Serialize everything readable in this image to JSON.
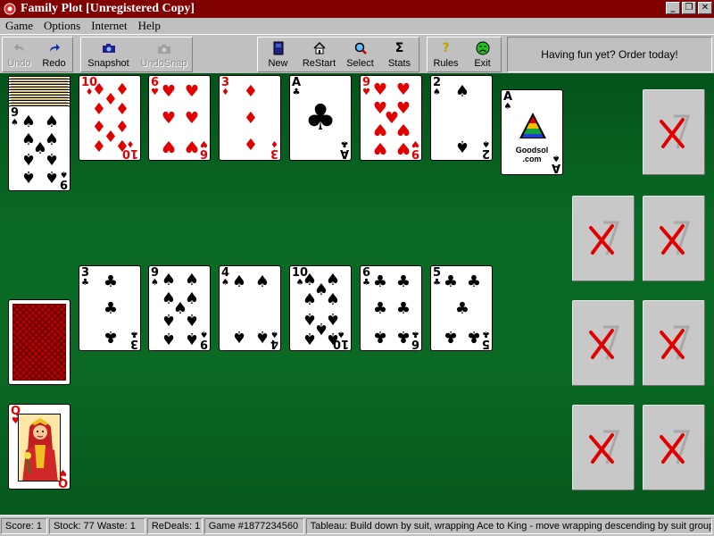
{
  "window": {
    "title": "Family Plot [Unregistered Copy]"
  },
  "menu": {
    "items": [
      "Game",
      "Options",
      "Internet",
      "Help"
    ]
  },
  "toolbar": {
    "undo": "Undo",
    "redo": "Redo",
    "snapshot": "Snapshot",
    "undosnap": "UndoSnap",
    "new": "New",
    "restart": "ReStart",
    "select": "Select",
    "stats": "Stats",
    "rules": "Rules",
    "exit": "Exit",
    "promo": "Having fun yet?  Order today!"
  },
  "cards": {
    "stock_top": {
      "rank": "9",
      "suit": "♠"
    },
    "foundation_ace": {
      "rank": "A",
      "suit": "♠",
      "brand": "Goodsol",
      "brand2": ".com"
    },
    "queen": {
      "rank": "Q",
      "suit": "♥"
    },
    "top_row": [
      {
        "rank": "10",
        "suit": "♦"
      },
      {
        "rank": "6",
        "suit": "♥"
      },
      {
        "rank": "3",
        "suit": "♦"
      },
      {
        "rank": "A",
        "suit": "♣"
      },
      {
        "rank": "9",
        "suit": "♥"
      },
      {
        "rank": "2",
        "suit": "♠"
      }
    ],
    "middle_row": [
      {
        "rank": "3",
        "suit": "♣"
      },
      {
        "rank": "9",
        "suit": "♠"
      },
      {
        "rank": "4",
        "suit": "♠"
      },
      {
        "rank": "10",
        "suit": "♠"
      },
      {
        "rank": "6",
        "suit": "♣"
      },
      {
        "rank": "5",
        "suit": "♣"
      }
    ]
  },
  "status": {
    "score": "Score:  1",
    "stock": "Stock: 77   Waste: 1",
    "redeals": "ReDeals: 1",
    "game": "Game #1877234560",
    "hint": "Tableau: Build down by suit, wrapping Ace to King - move wrapping descending by suit group"
  },
  "colors": {
    "titlebar": "#800000",
    "felt": "#0a6a24",
    "red_suit": "#e00000",
    "x_mark": "#e00000"
  },
  "icons": [
    "app-icon",
    "minimize-icon",
    "restore-icon",
    "close-icon",
    "undo-icon",
    "redo-icon",
    "camera-icon",
    "undosnap-icon",
    "new-deck-icon",
    "home-icon",
    "magnifier-icon",
    "sigma-icon",
    "question-icon",
    "frown-face-icon",
    "x-mark-icon"
  ]
}
